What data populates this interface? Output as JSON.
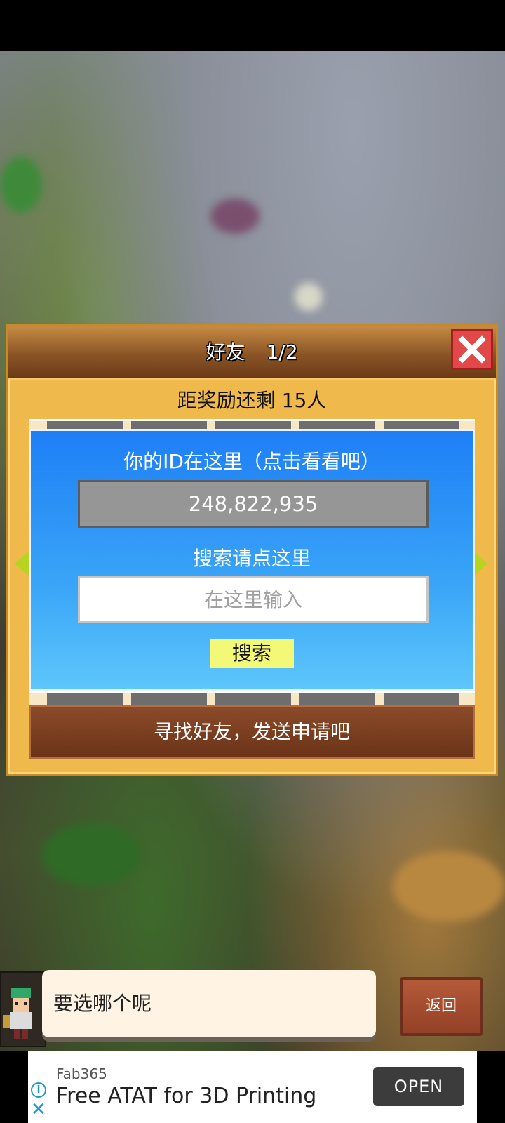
{
  "dialog": {
    "title": "好友",
    "page": "1/2",
    "subtitle": "距奖励还剩 15人",
    "id_label": "你的ID在这里（点击看看吧）",
    "id_value": "248,822,935",
    "search_label": "搜索请点这里",
    "search_placeholder": "在这里输入",
    "search_button": "搜索",
    "find_friends_button": "寻找好友，发送申请吧"
  },
  "bottom": {
    "speech_text": "要选哪个呢",
    "back_button": "返回"
  },
  "ad": {
    "source": "Fab365",
    "title": "Free ATAT for 3D Printing",
    "open_button": "OPEN",
    "info_icon": "i",
    "close_icon": "✕"
  },
  "colors": {
    "panel_blue": "#1e7ff6",
    "dialog_gold": "#f0b94c",
    "close_red": "#e24848",
    "search_button_yellow": "#f4f877",
    "find_button_brown": "#6b3418"
  }
}
